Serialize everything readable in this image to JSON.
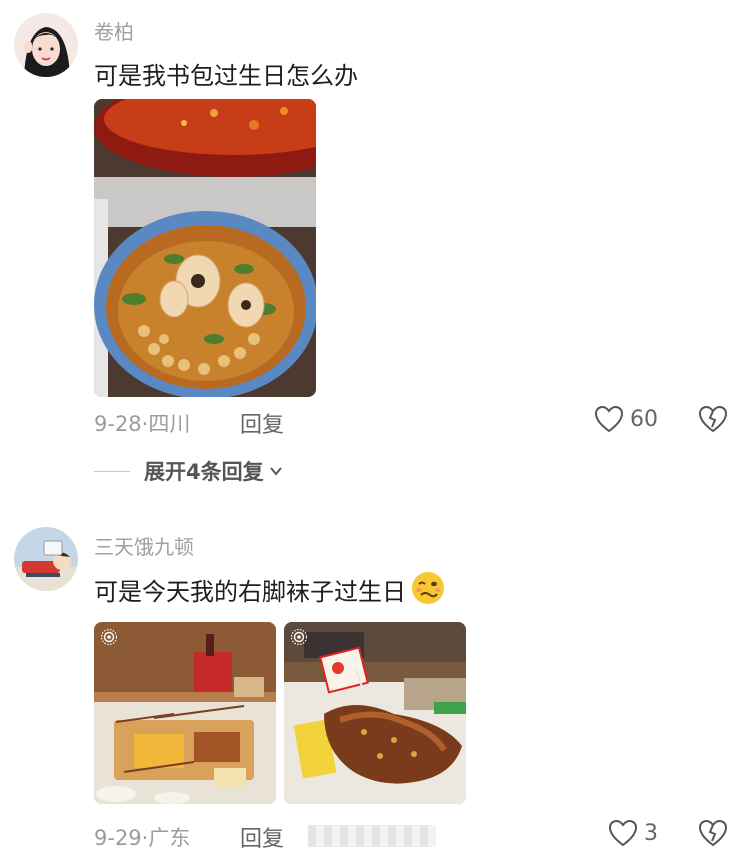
{
  "comments": [
    {
      "username": "卷柏",
      "text": "可是我书包过生日怎么办",
      "date_location": "9-28·四川",
      "reply_label": "回复",
      "like_count": "60",
      "expand_replies": "展开4条回复",
      "icons": {
        "like": "heart-outline-icon",
        "dislike": "broken-heart-icon",
        "expand": "chevron-down-icon"
      }
    },
    {
      "username": "三天饿九顿",
      "text": "可是今天我的右脚袜子过生日",
      "emoji": "woozy-face-emoji",
      "date_location": "9-29·广东",
      "reply_label": "回复",
      "like_count": "3",
      "icons": {
        "like": "heart-outline-icon",
        "dislike": "broken-heart-icon",
        "live_photo": "live-photo-icon"
      }
    }
  ],
  "colors": {
    "username": "#a0a0a0",
    "text": "#1e1e1e",
    "meta": "#9c9c9c"
  }
}
